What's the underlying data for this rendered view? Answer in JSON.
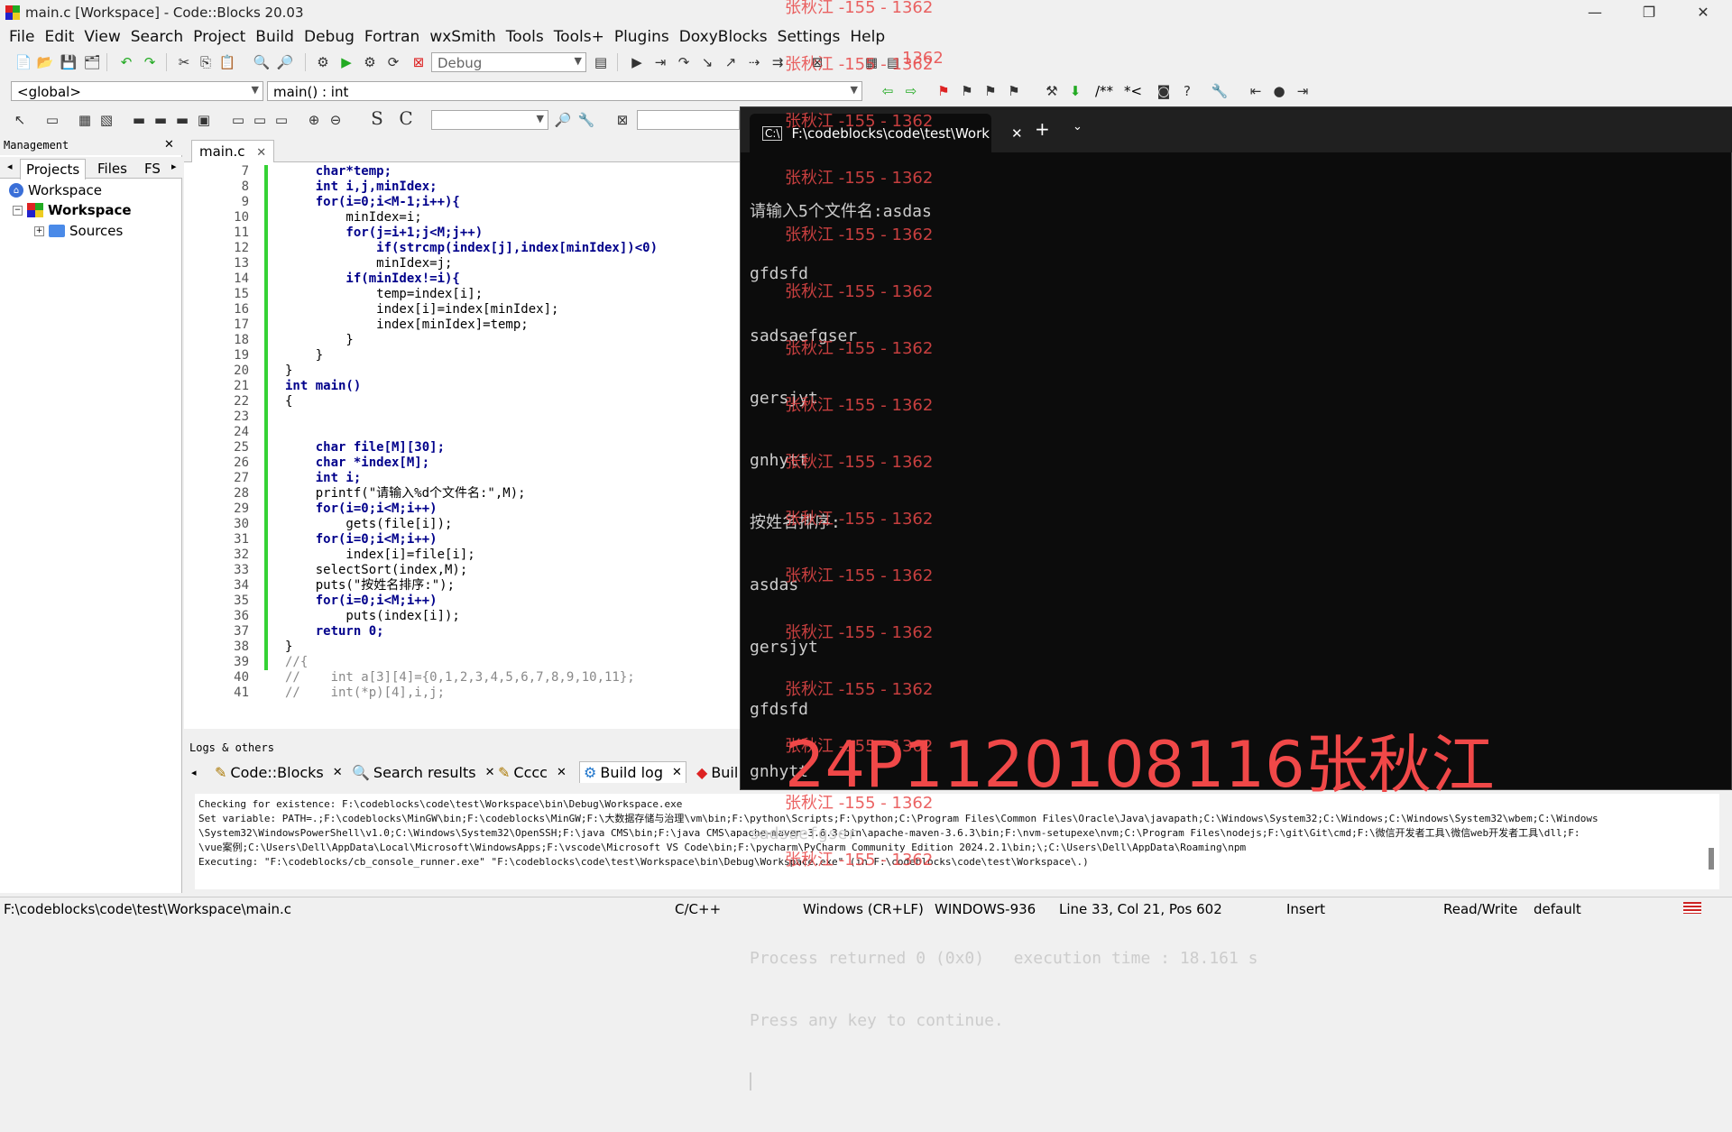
{
  "window": {
    "title": "main.c [Workspace] - Code::Blocks 20.03",
    "controls": [
      "—",
      "❐",
      "✕"
    ]
  },
  "menu": [
    "File",
    "Edit",
    "View",
    "Search",
    "Project",
    "Build",
    "Debug",
    "Fortran",
    "wxSmith",
    "Tools",
    "Tools+",
    "Plugins",
    "DoxyBlocks",
    "Settings",
    "Help"
  ],
  "toolbar": {
    "build_target": "Debug",
    "scope": "<global>",
    "symbol": "main() : int",
    "comment_btns": [
      "/**",
      "*<"
    ]
  },
  "management": {
    "title": "Management",
    "tabs": [
      "Projects",
      "Files",
      "FS"
    ],
    "tree": [
      "Workspace",
      "Workspace",
      "Sources"
    ]
  },
  "editor": {
    "tab": "main.c",
    "lines": [
      {
        "n": "7",
        "t": "    char*temp;"
      },
      {
        "n": "8",
        "t": "    int i,j,minIdex;"
      },
      {
        "n": "9",
        "t": "    for(i=0;i<M-1;i++){"
      },
      {
        "n": "10",
        "t": "        minIdex=i;"
      },
      {
        "n": "11",
        "t": "        for(j=i+1;j<M;j++)"
      },
      {
        "n": "12",
        "t": "            if(strcmp(index[j],index[minIdex])<0)"
      },
      {
        "n": "13",
        "t": "            minIdex=j;"
      },
      {
        "n": "14",
        "t": "        if(minIdex!=i){"
      },
      {
        "n": "15",
        "t": "            temp=index[i];"
      },
      {
        "n": "16",
        "t": "            index[i]=index[minIdex];"
      },
      {
        "n": "17",
        "t": "            index[minIdex]=temp;"
      },
      {
        "n": "18",
        "t": "        }"
      },
      {
        "n": "19",
        "t": "    }"
      },
      {
        "n": "20",
        "t": "}"
      },
      {
        "n": "21",
        "t": "int main()"
      },
      {
        "n": "22",
        "t": "{"
      },
      {
        "n": "23",
        "t": ""
      },
      {
        "n": "24",
        "t": ""
      },
      {
        "n": "25",
        "t": "    char file[M][30];"
      },
      {
        "n": "26",
        "t": "    char *index[M];"
      },
      {
        "n": "27",
        "t": "    int i;"
      },
      {
        "n": "28",
        "t": "    printf(\"请输入%d个文件名:\",M);"
      },
      {
        "n": "29",
        "t": "    for(i=0;i<M;i++)"
      },
      {
        "n": "30",
        "t": "        gets(file[i]);"
      },
      {
        "n": "31",
        "t": "    for(i=0;i<M;i++)"
      },
      {
        "n": "32",
        "t": "        index[i]=file[i];"
      },
      {
        "n": "33",
        "t": "    selectSort(index,M);"
      },
      {
        "n": "34",
        "t": "    puts(\"按姓名排序:\");"
      },
      {
        "n": "35",
        "t": "    for(i=0;i<M;i++)"
      },
      {
        "n": "36",
        "t": "        puts(index[i]);"
      },
      {
        "n": "37",
        "t": "    return 0;"
      },
      {
        "n": "38",
        "t": "}"
      },
      {
        "n": "39",
        "t": "//{"
      },
      {
        "n": "40",
        "t": "//    int a[3][4]={0,1,2,3,4,5,6,7,8,9,10,11};"
      },
      {
        "n": "41",
        "t": "//    int(*p)[4],i,j;"
      }
    ]
  },
  "logs": {
    "title": "Logs & others",
    "tabs": [
      "Code::Blocks",
      "Search results",
      "Cccc",
      "Build log",
      "Buil"
    ],
    "text": [
      "Checking for existence: F:\\codeblocks\\code\\test\\Workspace\\bin\\Debug\\Workspace.exe",
      "Set variable: PATH=.;F:\\codeblocks\\MinGW\\bin;F:\\codeblocks\\MinGW;F:\\大数据存储与治理\\vm\\bin;F:\\python\\Scripts;F:\\python;C:\\Program Files\\Common Files\\Oracle\\Java\\javapath;C:\\Windows\\System32;C:\\Windows;C:\\Windows\\System32\\wbem;C:\\Windows",
      "\\System32\\WindowsPowerShell\\v1.0;C:\\Windows\\System32\\OpenSSH;F:\\java CMS\\bin;F:\\java CMS\\apache-maven-3.6.3-bin\\apache-maven-3.6.3\\bin;F:\\nvm-setupexe\\nvm;C:\\Program Files\\nodejs;F:\\git\\Git\\cmd;F:\\微信开发者工具\\微信web开发者工具\\dll;F:",
      "\\vue案例;C:\\Users\\Dell\\AppData\\Local\\Microsoft\\WindowsApps;F:\\vscode\\Microsoft VS Code\\bin;F:\\pycharm\\PyCharm Community Edition 2024.2.1\\bin;\\;C:\\Users\\Dell\\AppData\\Roaming\\npm",
      "Executing: \"F:\\codeblocks/cb_console_runner.exe\" \"F:\\codeblocks\\code\\test\\Workspace\\bin\\Debug\\Workspace.exe\"  (in F:\\codeblocks\\code\\test\\Workspace\\.)"
    ]
  },
  "status": {
    "path": "F:\\codeblocks\\code\\test\\Workspace\\main.c",
    "lang": "C/C++",
    "eol": "Windows (CR+LF)",
    "encoding": "WINDOWS-936",
    "position": "Line 33, Col 21, Pos 602",
    "mode": "Insert",
    "access": "Read/Write",
    "profile": "default"
  },
  "terminal": {
    "tab_title": "F:\\codeblocks\\code\\test\\Work",
    "lines": [
      "请输入5个文件名:asdas",
      "gfdsfd",
      "sadsaefgser",
      "gersjyt",
      "gnhytt",
      "按姓名排序:",
      "asdas",
      "gersjyt",
      "gfdsfd",
      "gnhytt",
      "sadsaefgser",
      "",
      "Process returned 0 (0x0)   execution time : 18.161 s",
      "Press any key to continue."
    ]
  },
  "watermark": {
    "small": "张秋江 -155 - 1362",
    "small_alt": "1362",
    "big": "24P1120108116张秋江"
  }
}
